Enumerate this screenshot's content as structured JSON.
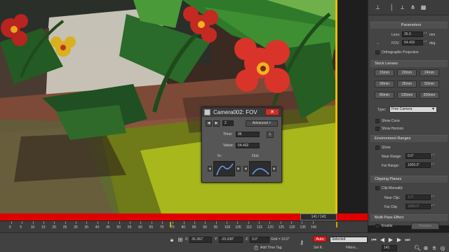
{
  "command_panel": {
    "tab_icons": [
      "pointer-icon",
      "tab-sep-icon",
      "pin-icon",
      "modifier-stack-icon",
      "unique-icon",
      "remove-modifier-icon",
      "configure-icon"
    ],
    "parameters": {
      "title": "Parameters",
      "lens_label": "Lens:",
      "lens_value": "35.0",
      "lens_unit": "mm",
      "fov_label": "FOV:",
      "fov_value": "54.432",
      "fov_unit": "deg.",
      "ortho_label": "Orthographic Projection"
    },
    "stock_lenses": {
      "title": "Stock Lenses",
      "buttons": [
        "15mm",
        "20mm",
        "24mm",
        "28mm",
        "35mm",
        "50mm",
        "85mm",
        "135mm",
        "200mm"
      ]
    },
    "type": {
      "label": "Type:",
      "value": "Free Camera"
    },
    "show_cone_label": "Show Cone",
    "show_horizon_label": "Show Horizon",
    "environment_ranges": {
      "title": "Environment Ranges",
      "show_label": "Show",
      "near_label": "Near Range:",
      "near_value": "0.0\"",
      "far_label": "Far Range:",
      "far_value": "1000.0\""
    },
    "clipping_planes": {
      "title": "Clipping Planes",
      "clip_manually_label": "Clip Manually",
      "near_label": "Near Clip:",
      "near_value": "1.0\"",
      "far_label": "Far Clip:",
      "far_value": "1000.0\""
    },
    "multipass": {
      "title": "Multi-Pass Effect",
      "enable_label": "Enable",
      "preview_label": "Preview"
    }
  },
  "dialog": {
    "title": "Camera002: FOV",
    "close_label": "✕",
    "key_number": "2",
    "advanced_label": "Advanced >",
    "time_label": "Time:",
    "time_value": "96",
    "lock_label": "L",
    "value_label": "Value:",
    "value_value": "54.432",
    "in_label": "In:",
    "out_label": "Out:"
  },
  "time_slider": {
    "label": "141 / 143"
  },
  "track_bar": {
    "ticks": [
      "0",
      "5",
      "10",
      "15",
      "20",
      "25",
      "30",
      "35",
      "40",
      "45",
      "50",
      "55",
      "60",
      "65",
      "70",
      "75",
      "80",
      "85",
      "90",
      "95",
      "100",
      "105",
      "110",
      "115",
      "120",
      "125",
      "130",
      "135",
      "140"
    ]
  },
  "status_bar": {
    "x_label": "X:",
    "x_value": "35.361\"",
    "y_label": "Y:",
    "y_value": "-25.038\"",
    "z_label": "Z:",
    "z_value": "0.0\"",
    "grid_label": "Grid = 10.0\"",
    "add_time_tag": "Add Time Tag",
    "auto_label": "Auto",
    "selected_label": "Selected",
    "set_key_label": "Set K.",
    "filters_label": "Filters...",
    "frame_value": "141"
  },
  "colors": {
    "time_slider_red": "#e00000",
    "viewport_border_yellow": "#e8c000",
    "close_button_red": "#c8302a",
    "auto_key_red": "#d81e1e"
  }
}
